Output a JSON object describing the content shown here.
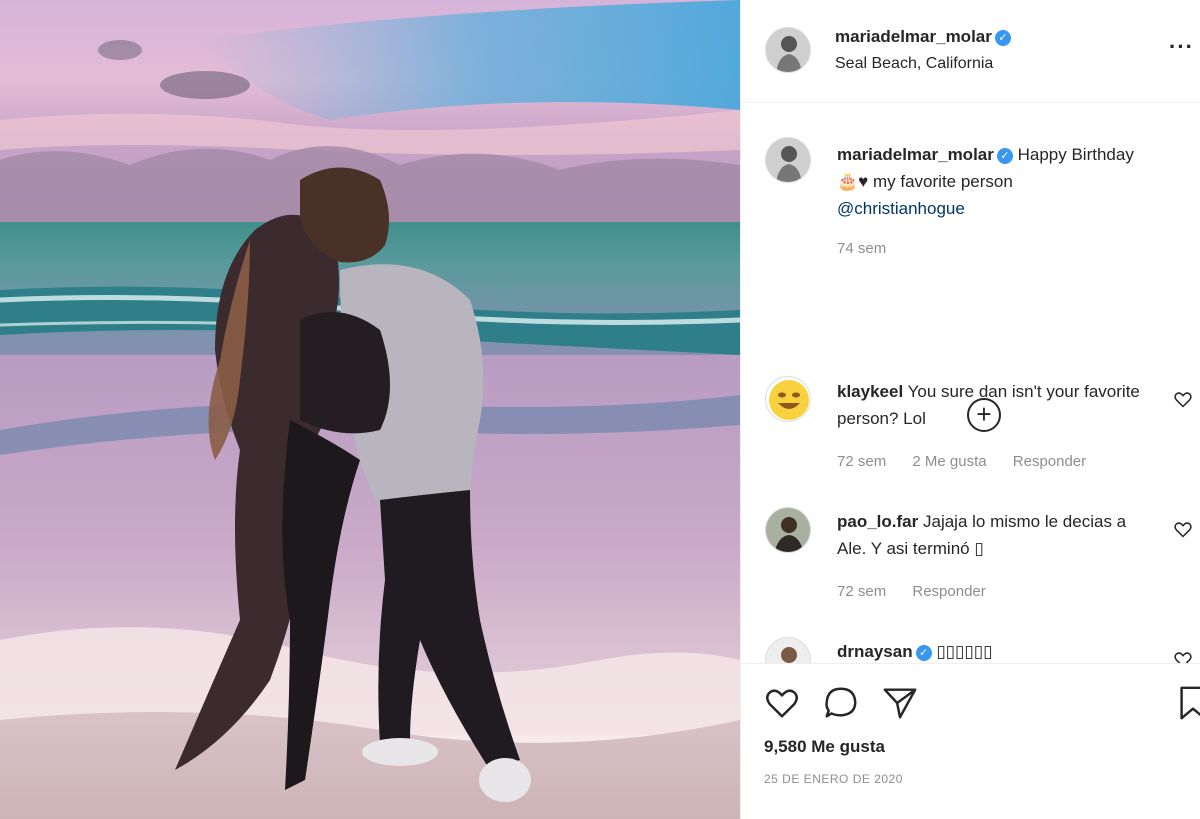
{
  "post": {
    "username": "mariadelmar_molar",
    "location": "Seal Beach, California",
    "more_label": "···"
  },
  "caption": {
    "username": "mariadelmar_molar",
    "text_a": "Happy Birthday",
    "text_b": "🎂♥ my favorite person",
    "mention": "@christianhogue",
    "time": "74 sem"
  },
  "load_more": "+",
  "comments": [
    {
      "username": "klaykeel",
      "text": "You sure dan isn't your favorite person? Lol",
      "time": "72 sem",
      "likes": "2 Me gusta",
      "reply": "Responder"
    },
    {
      "username": "pao_lo.far",
      "text": "Jajaja lo mismo le decias a Ale. Y asi terminó ▯",
      "time": "72 sem",
      "reply": "Responder"
    },
    {
      "username": "drnaysan",
      "text": "▯▯▯▯▯▯"
    }
  ],
  "actions": {
    "likes_count": "9,580 Me gusta",
    "date": "25 DE ENERO DE 2020",
    "icons": [
      "heart-icon",
      "comment-icon",
      "share-icon",
      "bookmark-icon"
    ]
  },
  "colors": {
    "verified": "#3897f0",
    "mention": "#00376b",
    "muted": "#8e8e8e",
    "text": "#262626"
  }
}
